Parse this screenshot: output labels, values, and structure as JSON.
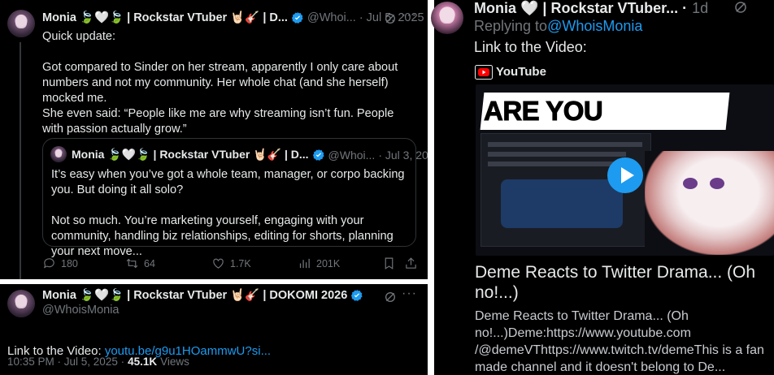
{
  "colors": {
    "accent": "#1d9bf0",
    "muted": "#71767b",
    "text": "#e7e9ea",
    "verified": "#1d9bf0",
    "youtube_red": "#ff0000"
  },
  "main_tweet": {
    "display_name": "Monia 🍃🤍🍃 | Rockstar VTuber 🤘🏻🎸 | D...",
    "handle": "@Whoi...",
    "date": "· Jul 5, 2025",
    "text": "Quick update:\n\nGot compared to Sinder on her stream, apparently I only care about numbers and not my community. Her whole chat (and she herself) mocked me.\nShe even said: “People like me are why streaming isn’t fun. People with passion actually grow.”",
    "quote": {
      "display_name": "Monia 🍃🤍🍃 | Rockstar VTuber 🤘🏻🎸 | D...",
      "handle": "@Whoi...",
      "date": "· Jul 3, 2025",
      "text": "It’s easy when you’ve got a whole team, manager, or corpo backing you. But doing it all solo?\n\nNot so much. You’re marketing yourself, engaging with your community, handling biz relationships, editing for shorts, planning your next move..."
    },
    "actions": {
      "replies": "180",
      "reposts": "64",
      "likes": "1.7K",
      "views": "201K"
    }
  },
  "reply_tweet": {
    "display_name": "Monia 🍃🤍🍃 | Rockstar VTuber 🤘🏻🎸 | DOKOMI 2026",
    "handle": "@WhoisMonia",
    "text_prefix": "Link to the Video: ",
    "link": "youtu.be/g9u1HOammwU?si...",
    "time": "10:35 PM · Jul 5, 2025 ·",
    "views_count": "45.1K",
    "views_label": "Views"
  },
  "right_reply": {
    "display_name": "Monia 🤍 | Rockstar VTuber... ·",
    "age": "1d",
    "replying_prefix": "Replying to ",
    "replying_handle": "@WhoisMonia",
    "text": "Link to the Video:",
    "source": "YouTube",
    "thumbnail_headline": "ARE YOU SERIOUS???",
    "card_title": "Deme Reacts to Twitter Drama... (Oh no!...)",
    "card_description": "Deme Reacts to Twitter Drama... (Oh no!...)Deme:https://www.youtube.com /@demeVThttps://www.twitch.tv/demeThis is a fan made channel and it doesn't belong to De..."
  }
}
